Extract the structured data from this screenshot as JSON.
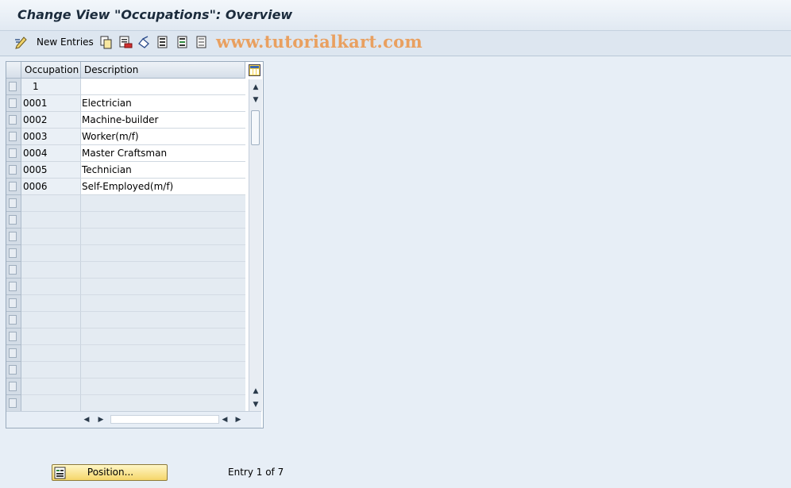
{
  "title": "Change View \"Occupations\": Overview",
  "toolbar": {
    "new_entries_label": "New Entries",
    "icons": [
      "edit-pencil-icon",
      "copy-icon",
      "delete-icon",
      "undo-icon",
      "select-all-icon",
      "select-block-icon",
      "deselect-all-icon"
    ]
  },
  "watermark": "www.tutorialkart.com",
  "table": {
    "columns": [
      "Occupation",
      "Description"
    ],
    "first_row_input": "1",
    "rows": [
      {
        "occupation": "0001",
        "description": "Electrician"
      },
      {
        "occupation": "0002",
        "description": "Machine-builder"
      },
      {
        "occupation": "0003",
        "description": "Worker(m/f)"
      },
      {
        "occupation": "0004",
        "description": "Master Craftsman"
      },
      {
        "occupation": "0005",
        "description": "Technician"
      },
      {
        "occupation": "0006",
        "description": "Self-Employed(m/f)"
      }
    ]
  },
  "footer": {
    "position_button_label": "Position...",
    "entry_info": "Entry 1 of 7"
  },
  "colors": {
    "background": "#e7eef6",
    "watermark": "#e9a060",
    "button": "#f5d66a"
  }
}
